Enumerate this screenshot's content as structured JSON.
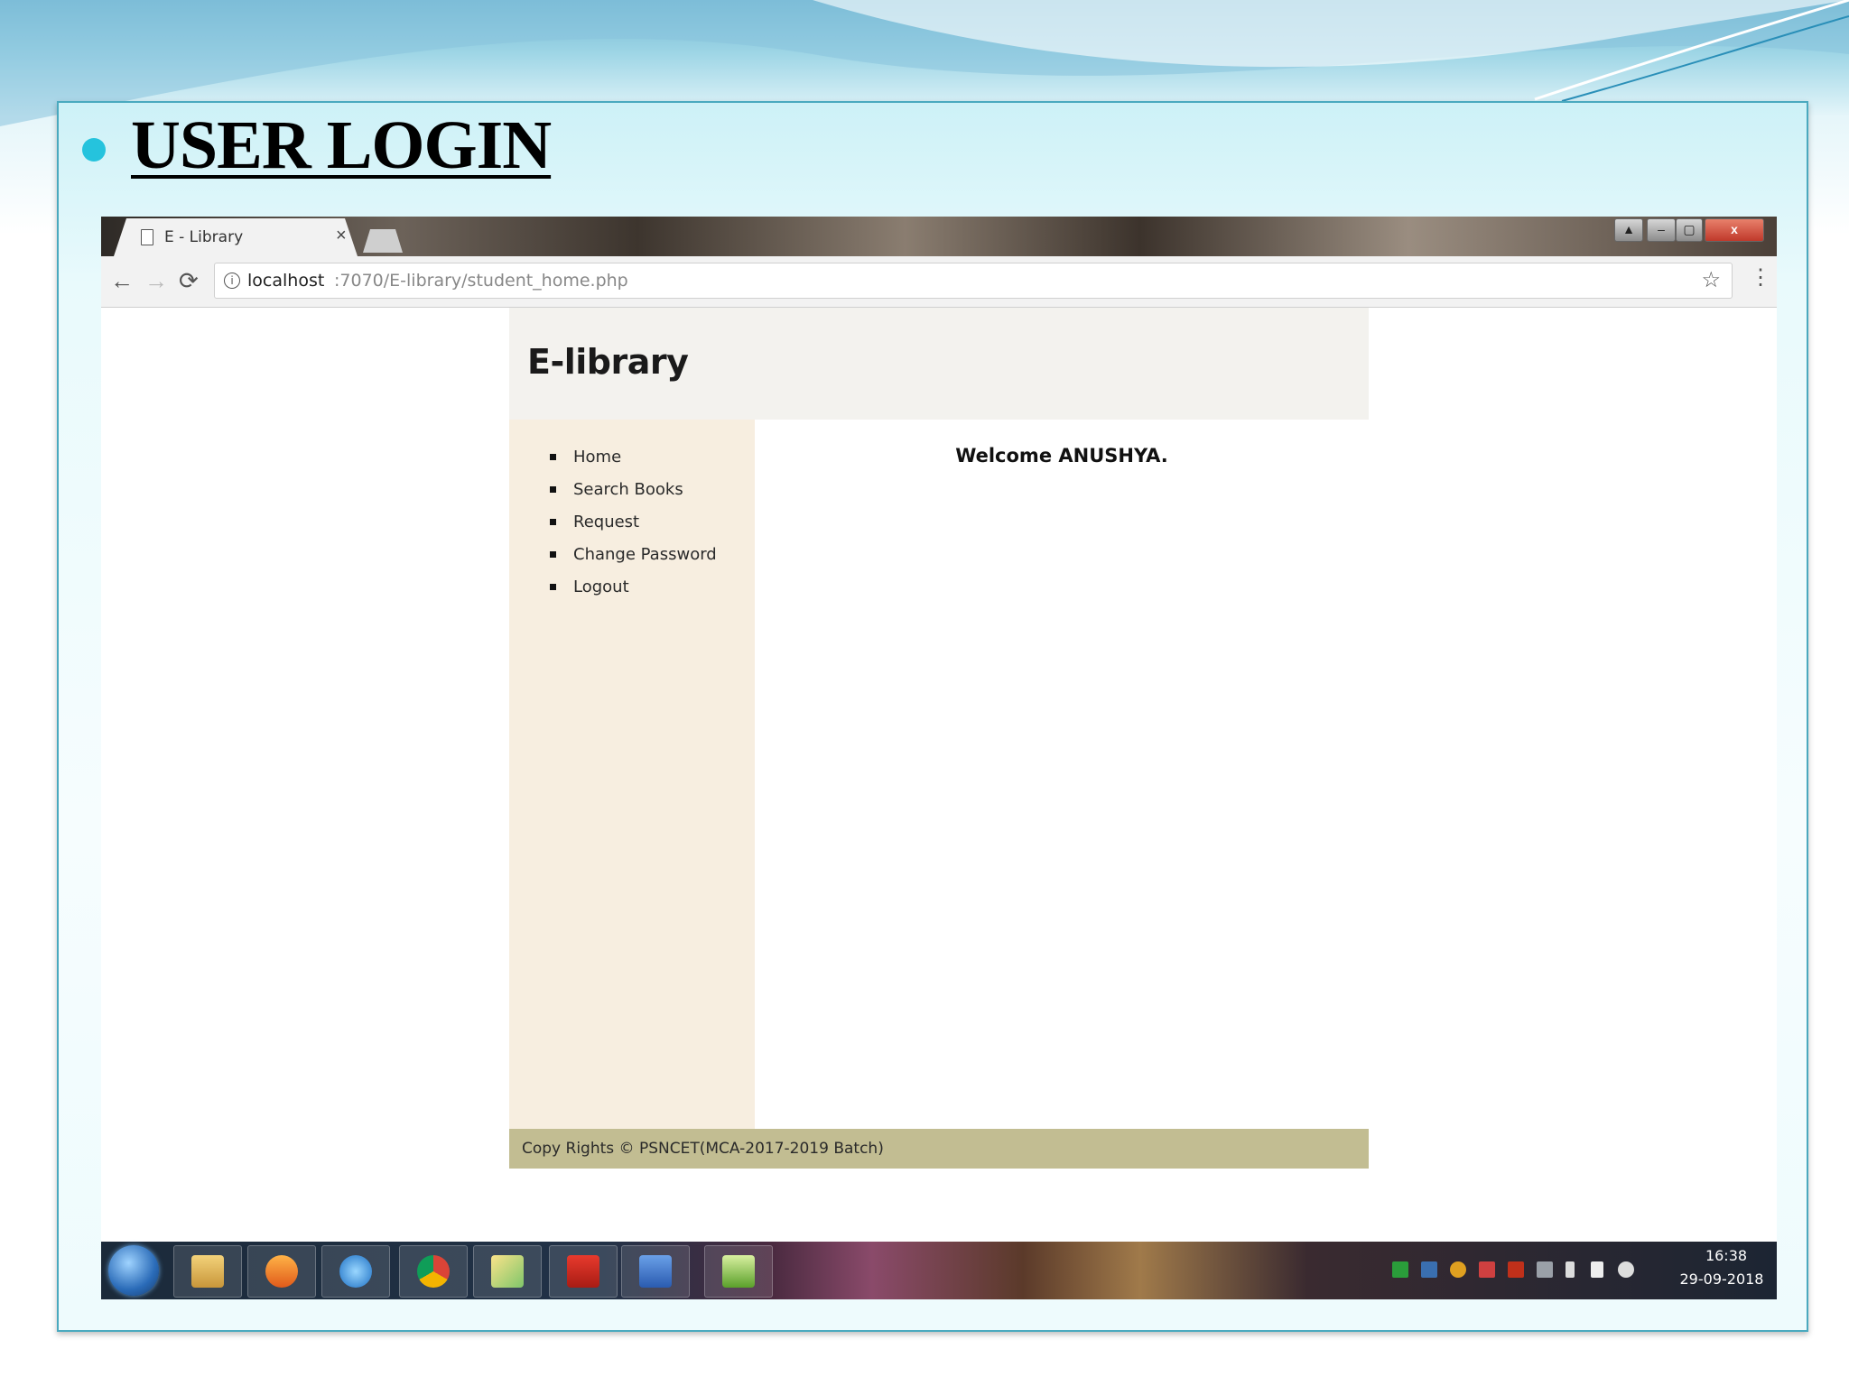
{
  "slide": {
    "title": "USER LOGIN",
    "accent_color": "#25c3dd"
  },
  "browser": {
    "tab_title": "E - Library",
    "tab_close": "×",
    "url_host": "localhost",
    "url_path": ":7070/E-library/student_home.php",
    "window_controls": {
      "user": "▲",
      "minimize": "–",
      "restore": "▢",
      "close": "x"
    }
  },
  "site": {
    "title": "E-library",
    "menu": [
      {
        "label": "Home"
      },
      {
        "label": "Search Books"
      },
      {
        "label": "Request"
      },
      {
        "label": "Change Password"
      },
      {
        "label": "Logout"
      }
    ],
    "welcome": "Welcome ANUSHYA.",
    "footer": "Copy Rights © PSNCET(MCA-2017-2019 Batch)",
    "colors": {
      "header": "#f3f2ee",
      "sidebar": "#f7eee0",
      "footer": "#c2bd92"
    }
  },
  "taskbar": {
    "apps": [
      "windows-explorer",
      "media-player",
      "internet-explorer",
      "chrome",
      "file-manager",
      "acrobat-reader",
      "ms-word",
      "chart-app"
    ],
    "clock_time": "16:38",
    "clock_date": "29-09-2018"
  }
}
